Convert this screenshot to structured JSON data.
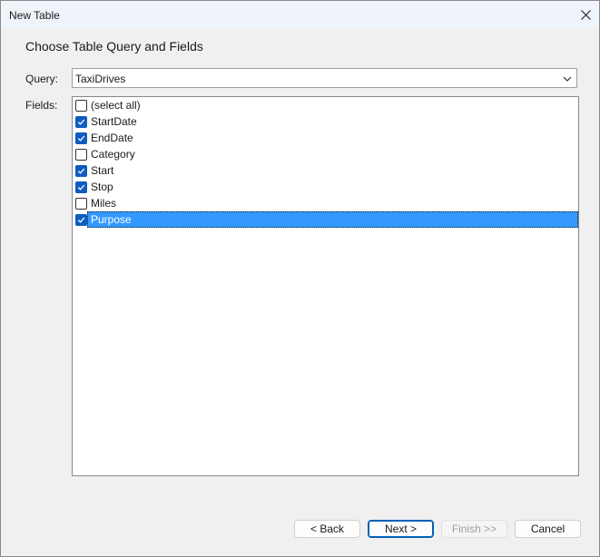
{
  "window": {
    "title": "New Table"
  },
  "heading": "Choose Table Query and Fields",
  "query": {
    "label": "Query:",
    "value": "TaxiDrives"
  },
  "fields": {
    "label": "Fields:",
    "items": [
      {
        "label": "(select all)",
        "checked": false,
        "selected": false
      },
      {
        "label": "StartDate",
        "checked": true,
        "selected": false
      },
      {
        "label": "EndDate",
        "checked": true,
        "selected": false
      },
      {
        "label": "Category",
        "checked": false,
        "selected": false
      },
      {
        "label": "Start",
        "checked": true,
        "selected": false
      },
      {
        "label": "Stop",
        "checked": true,
        "selected": false
      },
      {
        "label": "Miles",
        "checked": false,
        "selected": false
      },
      {
        "label": "Purpose",
        "checked": true,
        "selected": true
      }
    ]
  },
  "buttons": {
    "back": "< Back",
    "next": "Next >",
    "finish": "Finish >>",
    "cancel": "Cancel"
  },
  "colors": {
    "selection": "#3399ff",
    "checkbox_checked": "#0f5cbf",
    "default_button_border": "#005fb8"
  }
}
